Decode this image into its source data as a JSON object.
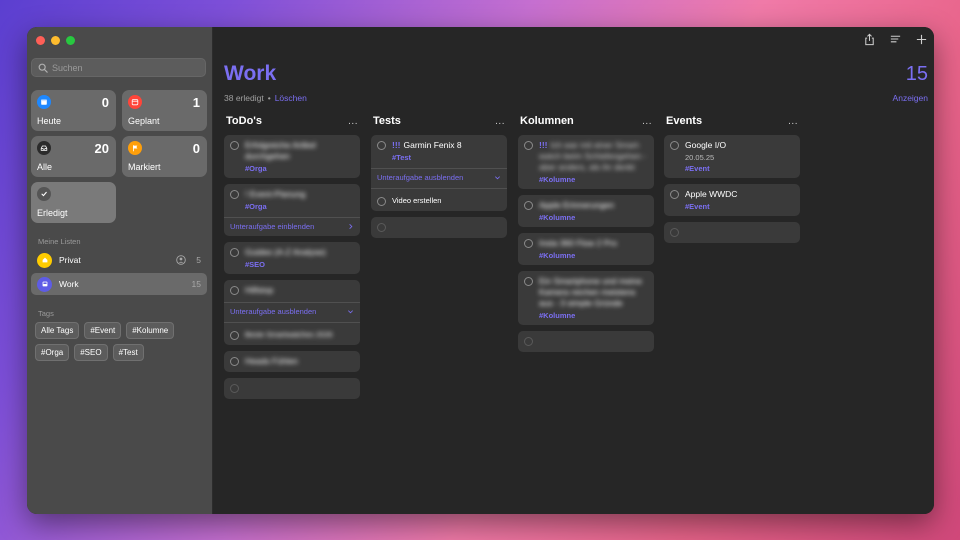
{
  "sidebar": {
    "search_placeholder": "Suchen",
    "smart_lists": [
      {
        "label": "Heute",
        "count": "0",
        "color": "#1e88ff",
        "icon": "calendar-icon"
      },
      {
        "label": "Geplant",
        "count": "1",
        "color": "#ff453a",
        "icon": "calendar-grid-icon"
      },
      {
        "label": "Alle",
        "count": "20",
        "color": "#3a3a3a",
        "icon": "tray-icon"
      },
      {
        "label": "Markiert",
        "count": "0",
        "color": "#ff9f0a",
        "icon": "flag-icon"
      },
      {
        "label": "Erledigt",
        "count": "",
        "color": "#555555",
        "icon": "checkmark-icon"
      }
    ],
    "my_lists_label": "Meine Listen",
    "lists": [
      {
        "name": "Privat",
        "count": "5",
        "color": "#ffcc00",
        "icon": "house-icon"
      },
      {
        "name": "Work",
        "count": "15",
        "color": "#5e5ce6",
        "icon": "monitor-icon"
      }
    ],
    "tags_label": "Tags",
    "tags": [
      "Alle Tags",
      "#Event",
      "#Kolumne",
      "#Orga",
      "#SEO",
      "#Test"
    ]
  },
  "main": {
    "title": "Work",
    "completed": "38 erledigt",
    "separator": "•",
    "delete": "Löschen",
    "count": "15",
    "show": "Anzeigen"
  },
  "columns": [
    {
      "title": "ToDo's",
      "more": "...",
      "cards": [
        {
          "text": "Erfolgreiche Artikel durchgehen",
          "tag": "#Orga",
          "blurred": true
        },
        {
          "text": "! Event-Planung",
          "tag": "#Orga",
          "blurred": true,
          "subtask_toggle": "Unteraufgabe einblenden",
          "toggle_icon": "chevron-right-icon"
        },
        {
          "text": "Guides (A-Z Analyse)",
          "tag": "#SEO",
          "blurred": true
        },
        {
          "text": "Hilfstop",
          "blurred": true,
          "subtask_toggle": "Unteraufgabe ausblenden",
          "toggle_icon": "chevron-down-icon",
          "subtask": "Beste Smartwatches 2026"
        },
        {
          "text": "Heads Fühlen",
          "blurred": true
        },
        {
          "empty": true
        }
      ]
    },
    {
      "title": "Tests",
      "more": "...",
      "cards": [
        {
          "priority": "!!!",
          "text": "Garmin Fenix 8",
          "tag": "#Test",
          "blurred": false,
          "subtask_toggle": "Unteraufgabe ausblenden",
          "toggle_icon": "chevron-down-icon",
          "subtask": "Video erstellen"
        },
        {
          "empty": true
        }
      ]
    },
    {
      "title": "Kolumnen",
      "more": "...",
      "cards": [
        {
          "priority": "!!!",
          "text": "Ich war mit einer Smart-watch beim Schlafengehen - aber anders, als ihr denkt",
          "tag": "#Kolumne",
          "blurred": true
        },
        {
          "text": "Apple Erinnerungen",
          "tag": "#Kolumne",
          "blurred": true
        },
        {
          "text": "Insta 360 Flow 2 Pro",
          "tag": "#Kolumne",
          "blurred": true
        },
        {
          "text": "Ein Smartphone und meine Kamera reichen meistens aus - 3 simple Gründe",
          "tag": "#Kolumne",
          "blurred": true
        },
        {
          "empty": true
        }
      ]
    },
    {
      "title": "Events",
      "more": "...",
      "cards": [
        {
          "text": "Google I/O",
          "date": "20.05.25",
          "tag": "#Event",
          "blurred": false
        },
        {
          "text": "Apple WWDC",
          "tag": "#Event",
          "blurred": false
        },
        {
          "empty": true
        }
      ]
    }
  ]
}
